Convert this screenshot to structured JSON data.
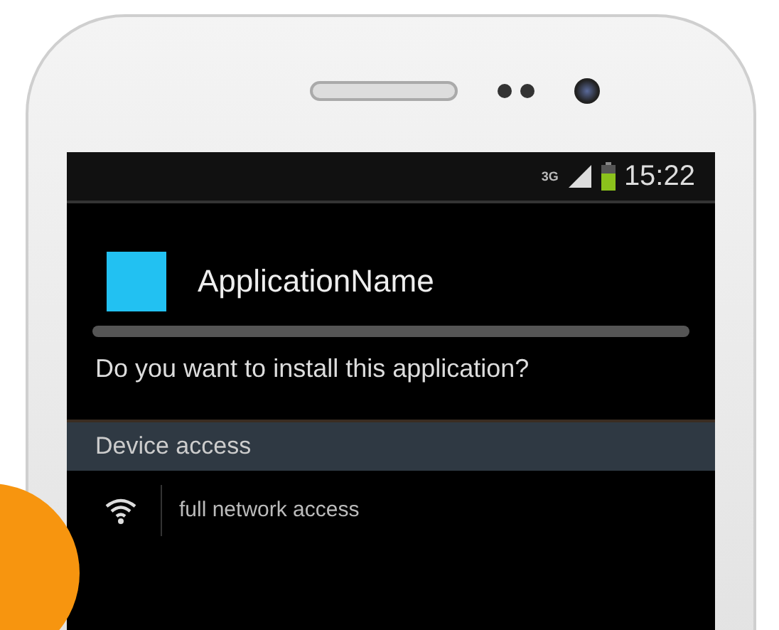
{
  "status_bar": {
    "network": "3G",
    "time": "15:22"
  },
  "app": {
    "name": "ApplicationName"
  },
  "prompt": "Do you want to install this application?",
  "section": {
    "title": "Device access"
  },
  "permissions": [
    {
      "kind": "network",
      "label": "full network access"
    }
  ]
}
